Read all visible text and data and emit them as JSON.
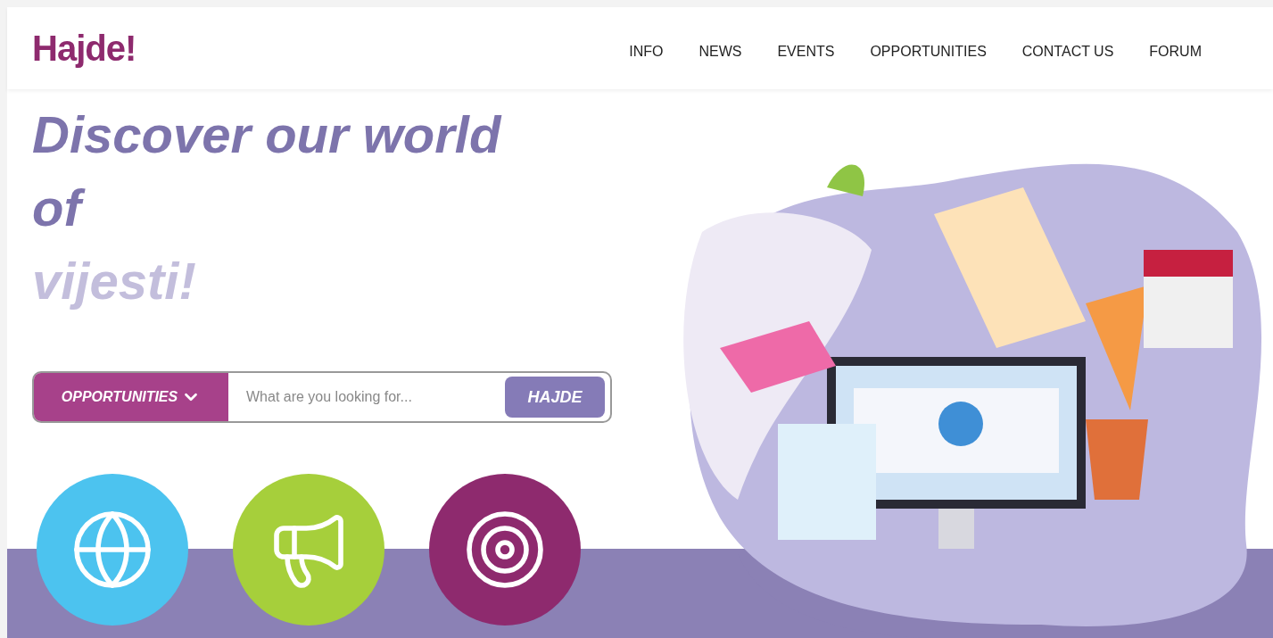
{
  "logo": "Hajde!",
  "nav": [
    {
      "label": "INFO"
    },
    {
      "label": "NEWS"
    },
    {
      "label": "EVENTS"
    },
    {
      "label": "OPPORTUNITIES"
    },
    {
      "label": "CONTACT US"
    },
    {
      "label": "FORUM"
    }
  ],
  "hero": {
    "title_lines": [
      {
        "text": "Discover our world",
        "faded": false
      },
      {
        "text": "of",
        "faded": false
      },
      {
        "text": "vijesti!",
        "faded": true
      }
    ]
  },
  "search": {
    "category": "OPPORTUNITIES",
    "placeholder": "What are you looking for...",
    "button": "HAJDE"
  },
  "features": [
    {
      "color": "#4cc3ef"
    },
    {
      "color": "#a6cf3b"
    },
    {
      "color": "#8e2a6e"
    }
  ]
}
